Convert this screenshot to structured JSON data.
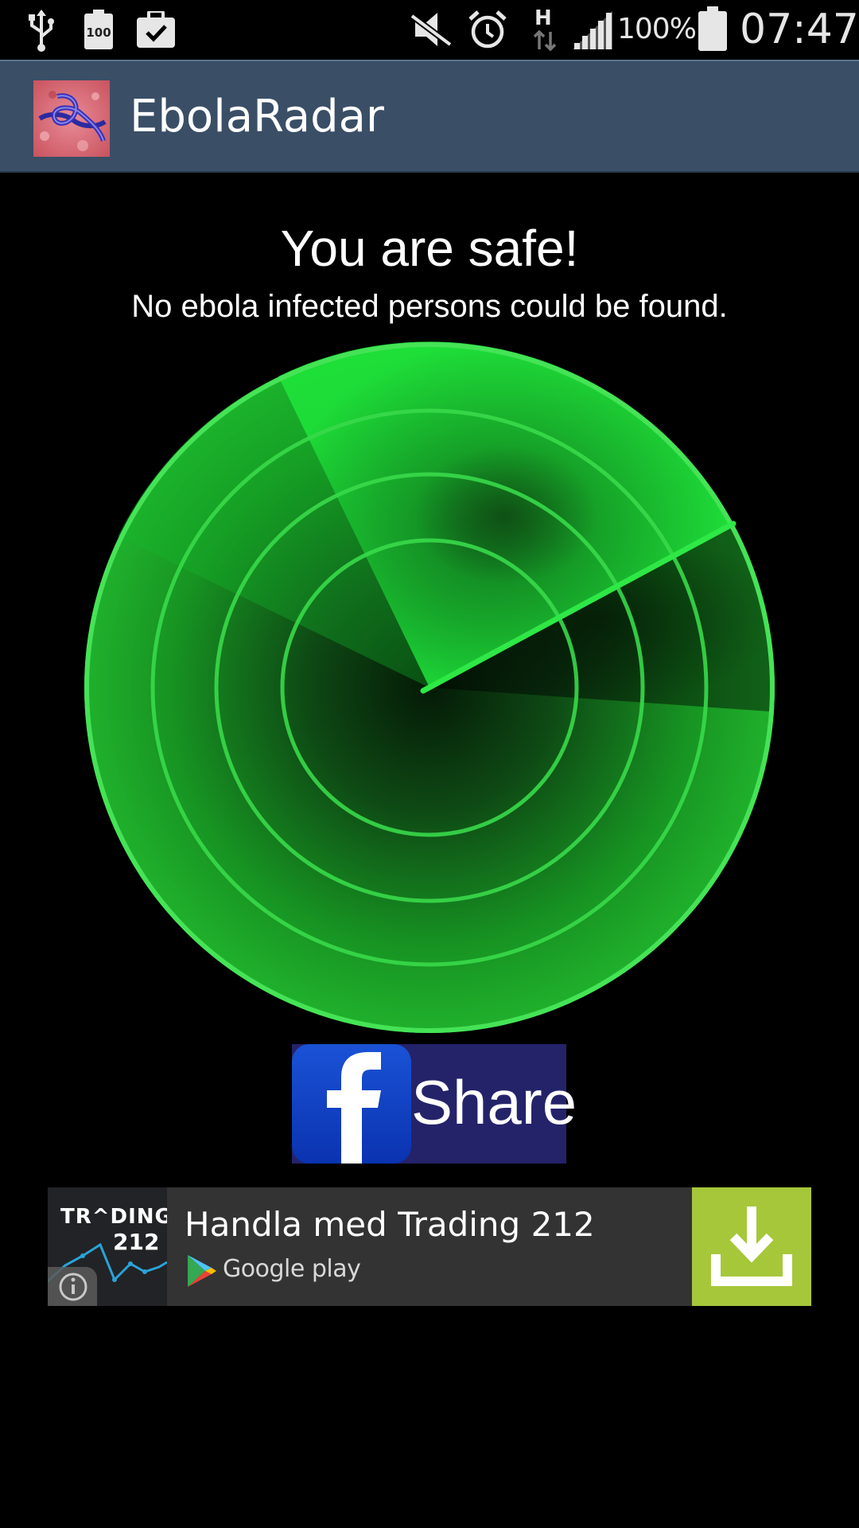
{
  "status_bar": {
    "battery_badge": "100",
    "network_type": "H",
    "battery_percent": "100%",
    "time": "07:47",
    "icons": [
      "usb-icon",
      "battery-full-badge-icon",
      "briefcase-check-icon",
      "vibrate-muted-icon",
      "alarm-icon",
      "data-transfer-icon",
      "signal-strength-icon",
      "battery-icon"
    ]
  },
  "action_bar": {
    "title": "EbolaRadar",
    "icon": "ebola-virus-icon"
  },
  "main": {
    "headline": "You are safe!",
    "subline": "No ebola infected persons could be found."
  },
  "radar": {
    "accent_color": "#17d42c",
    "ring_color": "#3de04a",
    "ring_count": 4
  },
  "share": {
    "label": "Share",
    "icon": "facebook-icon",
    "background": "#24236a"
  },
  "ad": {
    "logo_line1": "TR^DING",
    "logo_line2": "212",
    "title": "Handla med Trading 212",
    "store_label": "Google play",
    "info_icon": "info-icon",
    "download_icon": "download-icon",
    "download_color": "#a6c73a"
  }
}
